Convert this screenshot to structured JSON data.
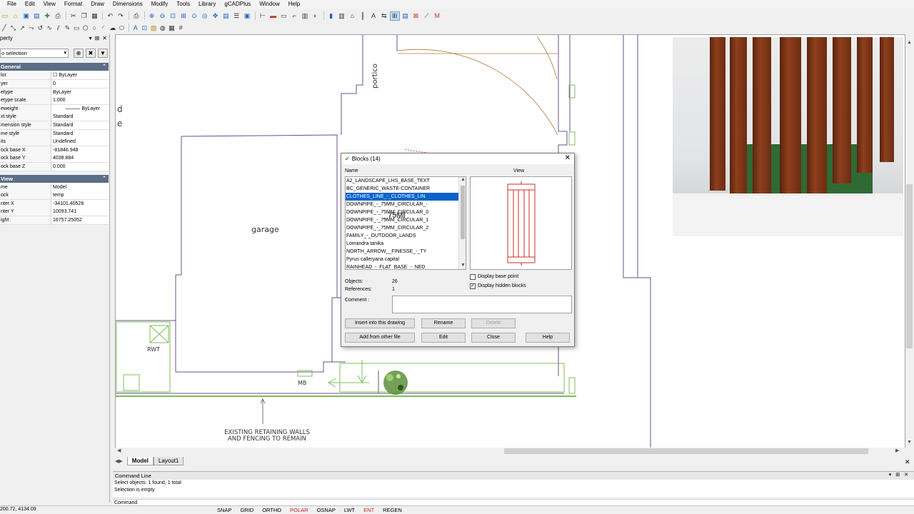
{
  "menubar": {
    "items": [
      "File",
      "Edit",
      "View",
      "Format",
      "Draw",
      "Dimensions",
      "Modify",
      "Tools",
      "Library",
      "gCADPlus",
      "Window",
      "Help"
    ]
  },
  "property_panel": {
    "title": "perty",
    "selection": "o selection",
    "general_header": "General",
    "general_rows": [
      {
        "key": "lor",
        "value": "ByLayer"
      },
      {
        "key": "yer",
        "value": "0"
      },
      {
        "key": "etype",
        "value": "ByLayer"
      },
      {
        "key": "etype scale",
        "value": "1.000"
      },
      {
        "key": "eweight",
        "value": "——— ByLayer"
      },
      {
        "key": "xt style",
        "value": "Standard"
      },
      {
        "key": "mension style",
        "value": "Standard"
      },
      {
        "key": "me style",
        "value": "Standard"
      },
      {
        "key": "its",
        "value": "Undefined"
      },
      {
        "key": "ock base X",
        "value": "-81846.948"
      },
      {
        "key": "ock base Y",
        "value": "4038.884"
      },
      {
        "key": "ock base Z",
        "value": "0.000"
      }
    ],
    "view_header": "View",
    "view_rows": [
      {
        "key": "me",
        "value": "Model"
      },
      {
        "key": "ock",
        "value": "temp"
      },
      {
        "key": "nter X",
        "value": "-34101.40528"
      },
      {
        "key": "nter Y",
        "value": "10093.741"
      },
      {
        "key": "ight",
        "value": "16757.25052"
      }
    ]
  },
  "drawing": {
    "labels": {
      "portico": "portico",
      "garage": "garage",
      "rwt": "RWT",
      "mb": "MB",
      "note_line1": "EXISTING RETAINING WALLS",
      "note_line2": "AND FENCING TO REMAIN",
      "partial1": "d",
      "partial2": "e"
    }
  },
  "tabs": [
    "Model",
    "Layout1"
  ],
  "command_line": {
    "title": "Command Line",
    "lines": [
      "Select objects: 1 found,  1 total",
      "Selection is empty"
    ],
    "prompt": "Command"
  },
  "statusbar": {
    "coords": "200.72, 4134.09",
    "buttons": [
      {
        "label": "SNAP",
        "on": false
      },
      {
        "label": "GRID",
        "on": false
      },
      {
        "label": "ORTHO",
        "on": false
      },
      {
        "label": "POLAR",
        "on": true
      },
      {
        "label": "OSNAP",
        "on": false
      },
      {
        "label": "LWT",
        "on": false
      },
      {
        "label": "ENT",
        "on": true
      },
      {
        "label": "REGEN",
        "on": false
      }
    ]
  },
  "blocks_dialog": {
    "title": "Blocks  (14)",
    "name_label": "Name",
    "view_label": "View",
    "items": [
      "A2_LANDSCAPE_LHS_BASE_TEXT",
      "BC_GENERIC_WASTE-CONTAINER",
      "CLOTHES_LINE_-_CLOTHES_LIN",
      "DOWNPIPE_-_75MM_CIRCULAR_-",
      "DOWNPIPE_-_75MM_CIRCULAR_0",
      "DOWNPIPE_-_75MM_CIRCULAR_1",
      "DOWNPIPE_-_75MM_CIRCULAR_2",
      "FAMILY_-_OUTDOOR_LANDS",
      "Lomandra tanika",
      "NORTH_ARROW__FINESSE_-_TY",
      "Pyrus calleryana capital",
      "RAINHEAD_-_FLAT_BASE_-_NED"
    ],
    "selected_index": 2,
    "hover_tooltip": "_75MI",
    "objects_label": "Objects:",
    "objects_value": "26",
    "references_label": "References:",
    "references_value": "1",
    "comment_label": "Comment :",
    "display_base_point": "Display base point",
    "display_hidden_blocks": "Display hidden blocks",
    "buttons": {
      "insert": "Insert into this drawing",
      "rename": "Rename",
      "delete": "Delete",
      "add_other": "Add from other file",
      "edit": "Edit",
      "close": "Close",
      "help": "Help"
    }
  },
  "colors": {
    "accent_selected": "#0a63c9",
    "section_header": "#5a6e85",
    "status_on": "#d62020",
    "drawing_line": "#6b4f8e",
    "drawing_line2": "#b07a3a",
    "hedge_green": "#7fbf5a",
    "preview_red": "#d22a2a"
  }
}
